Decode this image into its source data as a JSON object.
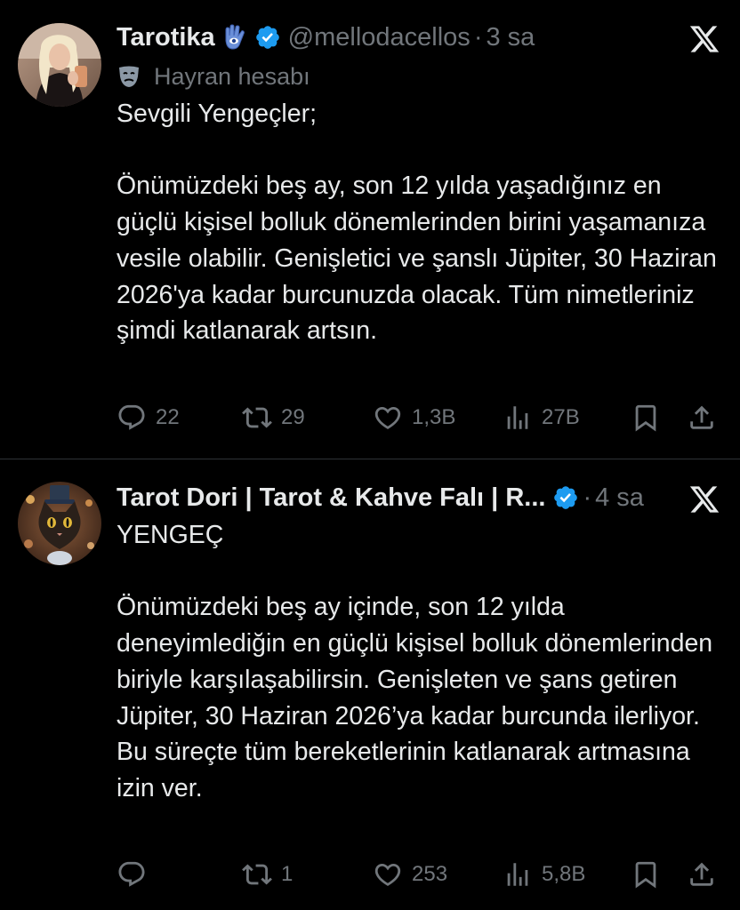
{
  "tweets": [
    {
      "display_name": "Tarotika",
      "name_badge": "hamsa-emoji",
      "handle": "@mellodacellos",
      "separator": "·",
      "time": "3 sa",
      "label": "Hayran hesabı",
      "label_icon": "theater-mask-icon",
      "text": "Sevgili Yengeçler;\n\nÖnümüzdeki beş ay, son 12 yılda yaşadığınız en güçlü kişisel bolluk dönemlerinden birini yaşamanıza vesile olabilir. Genişletici ve şanslı Jüpiter, 30 Haziran 2026'ya kadar burcunuzda olacak. Tüm nimetleriniz şimdi katlanarak artsın.",
      "stats": {
        "replies": "22",
        "reposts": "29",
        "likes": "1,3B",
        "views": "27B"
      }
    },
    {
      "display_name": "Tarot Dori | Tarot & Kahve Falı | R...",
      "handle": "",
      "separator": "·",
      "time": "4 sa",
      "text": "YENGEÇ\n\nÖnümüzdeki beş ay içinde, son 12 yılda deneyimlediğin en güçlü kişisel bolluk dönemlerinden biriyle karşılaşabilirsin. Genişleten ve şans getiren Jüpiter, 30 Haziran 2026’ya kadar burcunda ilerliyor. Bu süreçte tüm bereketlerinin katlanarak artmasına izin ver.",
      "stats": {
        "replies": "",
        "reposts": "1",
        "likes": "253",
        "views": "5,8B"
      }
    }
  ],
  "colors": {
    "background": "#000000",
    "text_primary": "#e7e9ea",
    "text_secondary": "#71767b",
    "verified": "#1d9bf0",
    "divider": "#2f3336"
  }
}
